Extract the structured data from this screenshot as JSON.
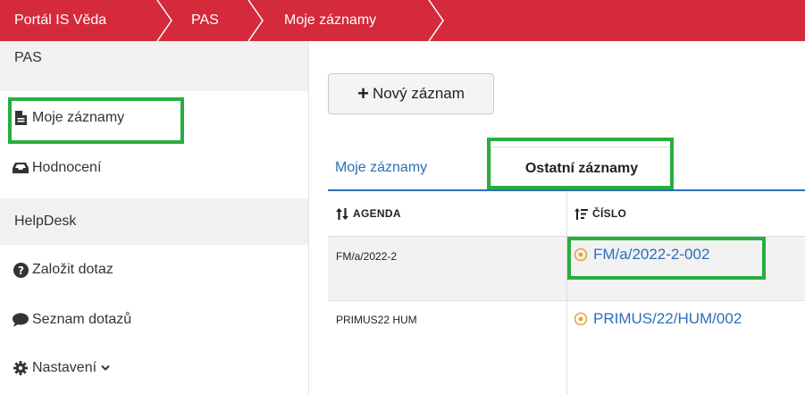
{
  "breadcrumb": {
    "items": [
      "Portál IS Věda",
      "PAS",
      "Moje záznamy"
    ]
  },
  "sidebar": {
    "section_pas": "PAS",
    "items_pas": [
      {
        "label": "Moje záznamy",
        "icon": "file-icon"
      },
      {
        "label": "Hodnocení",
        "icon": "inbox-icon"
      }
    ],
    "section_helpdesk": "HelpDesk",
    "items_helpdesk": [
      {
        "label": "Založit dotaz",
        "icon": "question-circle-icon"
      },
      {
        "label": "Seznam dotazů",
        "icon": "comment-icon"
      },
      {
        "label": "Nastavení",
        "icon": "gear-icon"
      }
    ]
  },
  "toolbar": {
    "new_record_label": "Nový záznam"
  },
  "tabs": [
    {
      "label": "Moje záznamy",
      "active": false
    },
    {
      "label": "Ostatní záznamy",
      "active": true
    }
  ],
  "table": {
    "columns": [
      "AGENDA",
      "ČÍSLO"
    ],
    "rows": [
      {
        "agenda": "FM/a/2022-2",
        "cislo": "FM/a/2022-2-002"
      },
      {
        "agenda": "PRIMUS22 HUM",
        "cislo": "PRIMUS/22/HUM/002"
      }
    ]
  },
  "colors": {
    "brand_red": "#d42a3c",
    "link_blue": "#2d6eb7",
    "highlight_green": "#27ae3f",
    "status_orange": "#e8a33a"
  }
}
